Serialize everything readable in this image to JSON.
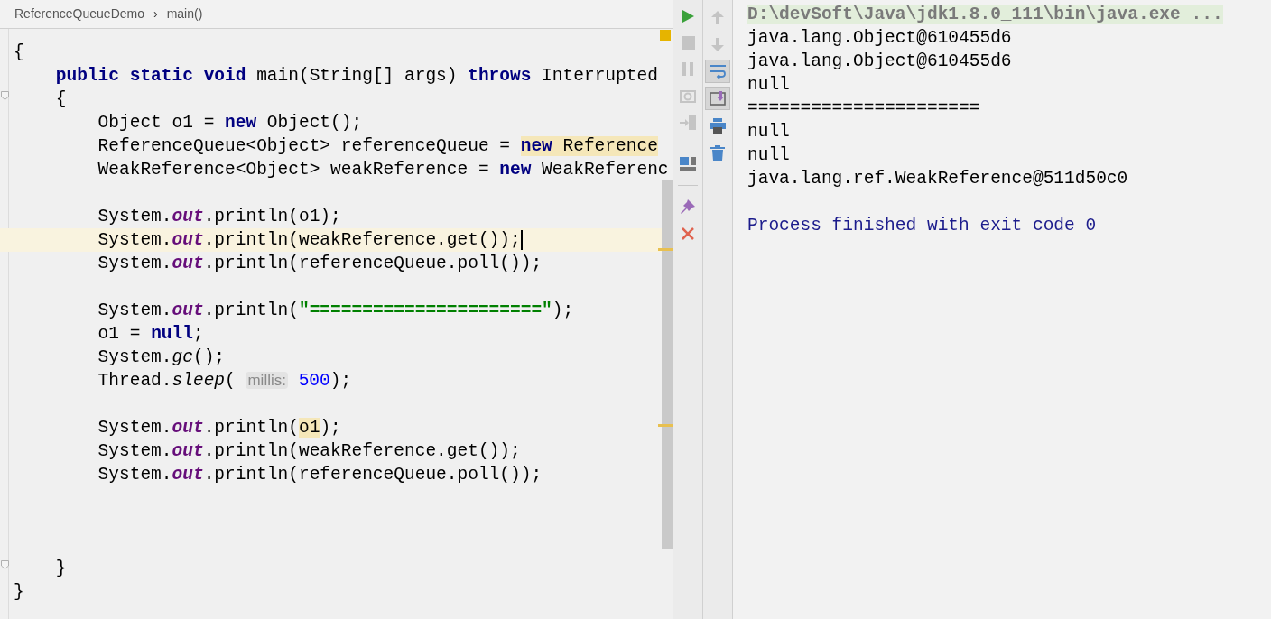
{
  "breadcrumb": {
    "items": [
      "ReferenceQueueDemo",
      "main()"
    ],
    "separator": "›"
  },
  "editor": {
    "lines": [
      {
        "current": false,
        "fold": false,
        "tokens": [
          {
            "kind": "plain",
            "text": "{"
          }
        ]
      },
      {
        "current": false,
        "fold": false,
        "tokens": [
          {
            "kind": "keyword",
            "text": "    public static void"
          },
          {
            "kind": "plain",
            "text": " main(String[] args) "
          },
          {
            "kind": "keyword",
            "text": "throws"
          },
          {
            "kind": "plain",
            "text": " Interrupted"
          }
        ]
      },
      {
        "current": false,
        "fold": true,
        "tokens": [
          {
            "kind": "plain",
            "text": "    {"
          }
        ]
      },
      {
        "current": false,
        "fold": false,
        "tokens": [
          {
            "kind": "plain",
            "text": "        Object o1 = "
          },
          {
            "kind": "keyword",
            "text": "new"
          },
          {
            "kind": "plain",
            "text": " Object();"
          }
        ]
      },
      {
        "current": false,
        "fold": false,
        "tokens": [
          {
            "kind": "plain",
            "text": "        ReferenceQueue<Object> referenceQueue = "
          },
          {
            "kind": "usage",
            "tokens": [
              {
                "kind": "keyword",
                "text": "new"
              },
              {
                "kind": "plain",
                "text": " Reference"
              }
            ]
          }
        ]
      },
      {
        "current": false,
        "fold": false,
        "tokens": [
          {
            "kind": "plain",
            "text": "        WeakReference<Object> weakReference = "
          },
          {
            "kind": "keyword",
            "text": "new"
          },
          {
            "kind": "plain",
            "text": " WeakReferenc"
          }
        ]
      },
      {
        "current": false,
        "fold": false
      },
      {
        "current": false,
        "fold": false,
        "tokens": [
          {
            "kind": "plain",
            "text": "        System."
          },
          {
            "kind": "field",
            "text": "out"
          },
          {
            "kind": "plain",
            "text": ".println(o1);"
          }
        ]
      },
      {
        "current": true,
        "fold": false,
        "tokens": [
          {
            "kind": "plain",
            "text": "        System."
          },
          {
            "kind": "field",
            "text": "out"
          },
          {
            "kind": "plain",
            "text": ".println(weakReference.get());"
          }
        ]
      },
      {
        "current": false,
        "fold": false,
        "tokens": [
          {
            "kind": "plain",
            "text": "        System."
          },
          {
            "kind": "field",
            "text": "out"
          },
          {
            "kind": "plain",
            "text": ".println(referenceQueue.poll());"
          }
        ]
      },
      {
        "current": false,
        "fold": false
      },
      {
        "current": false,
        "fold": false,
        "tokens": [
          {
            "kind": "plain",
            "text": "        System."
          },
          {
            "kind": "field",
            "text": "out"
          },
          {
            "kind": "plain",
            "text": ".println("
          },
          {
            "kind": "string",
            "text": "\"======================\""
          },
          {
            "kind": "plain",
            "text": ");"
          }
        ]
      },
      {
        "current": false,
        "fold": false,
        "tokens": [
          {
            "kind": "plain",
            "text": "        o1 = "
          },
          {
            "kind": "keyword",
            "text": "null"
          },
          {
            "kind": "plain",
            "text": ";"
          }
        ]
      },
      {
        "current": false,
        "fold": false,
        "tokens": [
          {
            "kind": "plain",
            "text": "        System."
          },
          {
            "kind": "static",
            "text": "gc"
          },
          {
            "kind": "plain",
            "text": "();"
          }
        ]
      },
      {
        "current": false,
        "fold": false,
        "tokens": [
          {
            "kind": "plain",
            "text": "        Thread."
          },
          {
            "kind": "static",
            "text": "sleep"
          },
          {
            "kind": "plain",
            "text": "( "
          },
          {
            "kind": "hint",
            "text": "millis:"
          },
          {
            "kind": "number",
            "text": " 500"
          },
          {
            "kind": "plain",
            "text": ");"
          }
        ]
      },
      {
        "current": false,
        "fold": false
      },
      {
        "current": false,
        "fold": false,
        "tokens": [
          {
            "kind": "plain",
            "text": "        System."
          },
          {
            "kind": "field",
            "text": "out"
          },
          {
            "kind": "plain",
            "text": ".println("
          },
          {
            "kind": "usage",
            "tokens": [
              {
                "kind": "plain",
                "text": "o1"
              }
            ]
          },
          {
            "kind": "plain",
            "text": ");"
          }
        ]
      },
      {
        "current": false,
        "fold": false,
        "tokens": [
          {
            "kind": "plain",
            "text": "        System."
          },
          {
            "kind": "field",
            "text": "out"
          },
          {
            "kind": "plain",
            "text": ".println(weakReference.get());"
          }
        ]
      },
      {
        "current": false,
        "fold": false,
        "tokens": [
          {
            "kind": "plain",
            "text": "        System."
          },
          {
            "kind": "field",
            "text": "out"
          },
          {
            "kind": "plain",
            "text": ".println(referenceQueue.poll());"
          }
        ]
      },
      {
        "current": false,
        "fold": false
      },
      {
        "current": false,
        "fold": false
      },
      {
        "current": false,
        "fold": false
      },
      {
        "current": false,
        "fold": true,
        "tokens": [
          {
            "kind": "plain",
            "text": "    }"
          }
        ]
      },
      {
        "current": false,
        "fold": false,
        "tokens": [
          {
            "kind": "plain",
            "text": "}"
          }
        ]
      }
    ]
  },
  "run_toolbar": [
    {
      "kind": "run",
      "disabled": false
    },
    {
      "kind": "stop",
      "disabled": true
    },
    {
      "kind": "pause",
      "disabled": true
    },
    {
      "kind": "camera",
      "disabled": true
    },
    {
      "kind": "exit",
      "disabled": true
    },
    {
      "kind": "divider"
    },
    {
      "kind": "layout",
      "disabled": false
    },
    {
      "kind": "divider"
    },
    {
      "kind": "pin",
      "disabled": false
    },
    {
      "kind": "close",
      "disabled": false
    }
  ],
  "console_toolbar": [
    {
      "kind": "up",
      "disabled": true,
      "selected": false
    },
    {
      "kind": "down",
      "disabled": true,
      "selected": false
    },
    {
      "kind": "wrap",
      "disabled": false,
      "selected": true
    },
    {
      "kind": "scroll-end",
      "disabled": false,
      "selected": true
    },
    {
      "kind": "print",
      "disabled": false,
      "selected": false
    },
    {
      "kind": "trash",
      "disabled": false,
      "selected": false
    }
  ],
  "console": {
    "lines": [
      {
        "kind": "command",
        "text": "D:\\devSoft\\Java\\jdk1.8.0_111\\bin\\java.exe ..."
      },
      {
        "kind": "output",
        "text": "java.lang.Object@610455d6"
      },
      {
        "kind": "output",
        "text": "java.lang.Object@610455d6"
      },
      {
        "kind": "output",
        "text": "null"
      },
      {
        "kind": "output",
        "text": "======================"
      },
      {
        "kind": "output",
        "text": "null"
      },
      {
        "kind": "output",
        "text": "null"
      },
      {
        "kind": "output",
        "text": "java.lang.ref.WeakReference@511d50c0"
      },
      {
        "kind": "blank"
      },
      {
        "kind": "exit",
        "text": "Process finished with exit code 0"
      }
    ]
  }
}
